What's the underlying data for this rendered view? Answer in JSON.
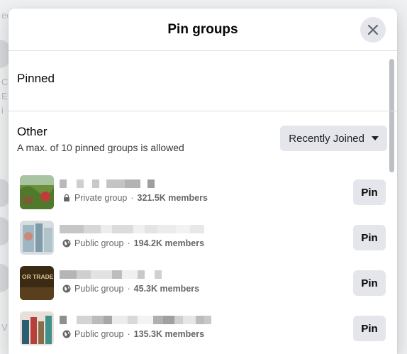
{
  "background": {
    "fragments": [
      "ec",
      "C",
      "E",
      "i",
      "V"
    ]
  },
  "modal": {
    "title": "Pin groups",
    "close_icon": "close-icon"
  },
  "pinned": {
    "heading": "Pinned"
  },
  "other": {
    "heading": "Other",
    "subtitle": "A max. of 10 pinned groups is allowed",
    "sort_label": "Recently Joined"
  },
  "groups": [
    {
      "privacy": "Private group",
      "members": "321.5K members",
      "icon": "lock-icon",
      "pin_label": "Pin"
    },
    {
      "privacy": "Public group",
      "members": "194.2K members",
      "icon": "globe-icon",
      "pin_label": "Pin"
    },
    {
      "privacy": "Public group",
      "members": "45.3K members",
      "icon": "globe-icon",
      "pin_label": "Pin",
      "thumb_text": "OR TRADE"
    },
    {
      "privacy": "Public group",
      "members": "135.3K members",
      "icon": "globe-icon",
      "pin_label": "Pin"
    }
  ],
  "colors": {
    "button_bg": "#e4e6eb",
    "secondary_text": "#65676b",
    "divider": "#dadde1"
  }
}
